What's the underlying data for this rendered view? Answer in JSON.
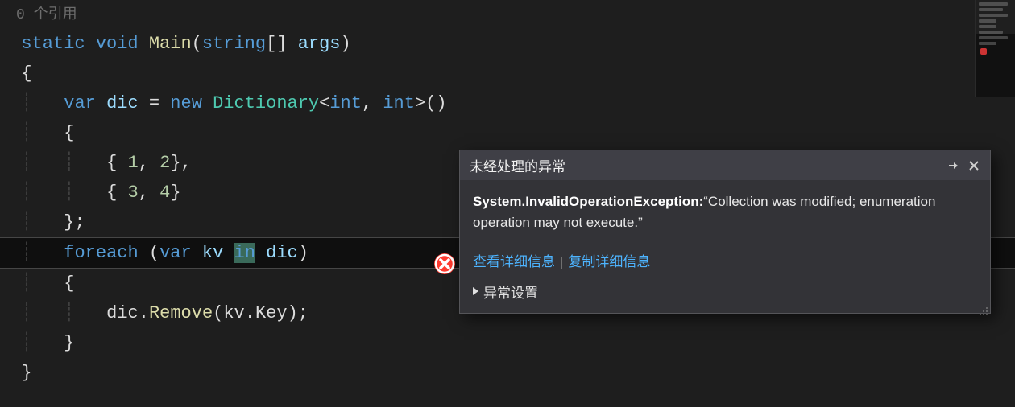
{
  "colors": {
    "accent": "#569cd6",
    "type": "#4ec9b0",
    "method": "#dcdcaa",
    "num": "#b5cea8",
    "link": "#4db4ff",
    "error": "#ff3b30"
  },
  "codelens": {
    "references": "0 个引用"
  },
  "code": {
    "kw_static": "static",
    "kw_void": "void",
    "method_main": "Main",
    "paren_open": "(",
    "kw_string": "string",
    "brackets": "[]",
    "param_args": "args",
    "paren_close": ")",
    "brace_open": "{",
    "brace_close": "}",
    "kw_var": "var",
    "id_dic": "dic",
    "eq": " = ",
    "kw_new": "new",
    "type_dict": "Dictionary",
    "lt": "<",
    "kw_int1": "int",
    "comma_sp": ", ",
    "kw_int2": "int",
    "gt": ">",
    "parens": "()",
    "row1_o": "{ ",
    "row1_a": "1",
    "row1_c": ", ",
    "row1_b": "2",
    "row1_e": "},",
    "row2_o": "{ ",
    "row2_a": "3",
    "row2_c": ", ",
    "row2_b": "4",
    "row2_e": "}",
    "semi": ";",
    "brace_close_semi": "};",
    "kw_foreach": "foreach",
    "id_kv": "kv",
    "kw_in": "in",
    "method_remove": "Remove",
    "prop_key": "Key",
    "dot": "."
  },
  "exception": {
    "title": "未经处理的异常",
    "type": "System.InvalidOperationException:",
    "message": "“Collection was modified; enumeration operation may not execute.”",
    "link_details": "查看详细信息",
    "link_copy": "复制详细信息",
    "settings": "异常设置"
  }
}
